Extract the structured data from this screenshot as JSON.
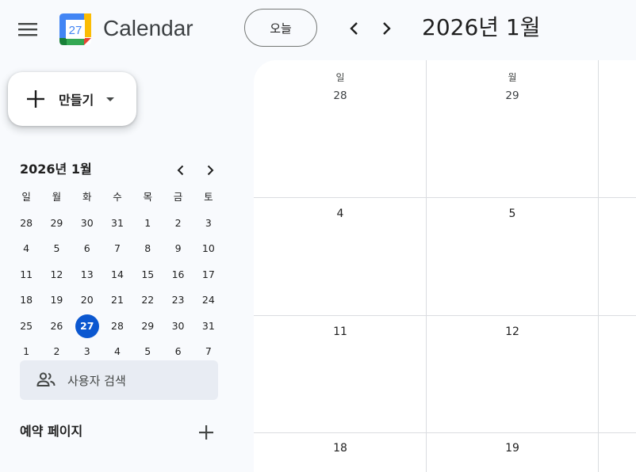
{
  "header": {
    "app_title": "Calendar",
    "logo_number": "27",
    "today_label": "오늘",
    "current_range": "2026년 1월"
  },
  "sidebar": {
    "create_label": "만들기",
    "mini_calendar": {
      "title": "2026년 1월",
      "weekdays": [
        "일",
        "월",
        "화",
        "수",
        "목",
        "금",
        "토"
      ],
      "weeks": [
        [
          "28",
          "29",
          "30",
          "31",
          "1",
          "2",
          "3"
        ],
        [
          "4",
          "5",
          "6",
          "7",
          "8",
          "9",
          "10"
        ],
        [
          "11",
          "12",
          "13",
          "14",
          "15",
          "16",
          "17"
        ],
        [
          "18",
          "19",
          "20",
          "21",
          "22",
          "23",
          "24"
        ],
        [
          "25",
          "26",
          "27",
          "28",
          "29",
          "30",
          "31"
        ],
        [
          "1",
          "2",
          "3",
          "4",
          "5",
          "6",
          "7"
        ]
      ],
      "selected": "27"
    },
    "search_people_label": "사용자 검색",
    "booking_pages_label": "예약 페이지"
  },
  "main": {
    "weekdays": [
      "일",
      "월"
    ],
    "weeks": [
      [
        "28",
        "29"
      ],
      [
        "4",
        "5"
      ],
      [
        "11",
        "12"
      ],
      [
        "18",
        "19"
      ]
    ]
  },
  "colors": {
    "accent": "#0b57d0",
    "background": "#f8fafd",
    "grid_line": "#dadce0"
  }
}
